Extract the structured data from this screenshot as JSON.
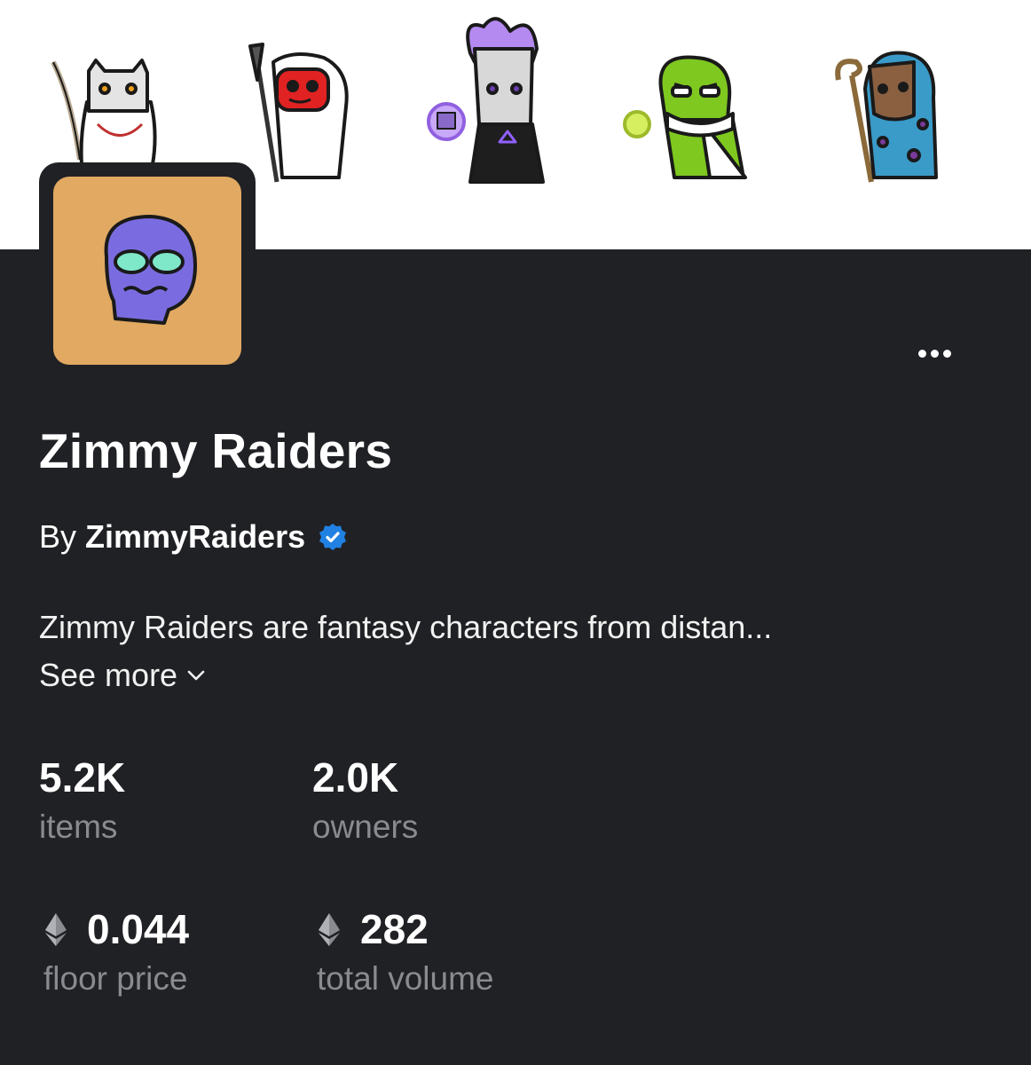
{
  "collection": {
    "title": "Zimmy Raiders",
    "by_prefix": "By",
    "creator": "ZimmyRaiders",
    "verified_icon": "verified-badge-icon",
    "description": "Zimmy Raiders are fantasy characters from distan...",
    "see_more": "See more",
    "more_icon": "ellipsis-icon"
  },
  "stats": {
    "items": {
      "value": "5.2K",
      "label": "items"
    },
    "owners": {
      "value": "2.0K",
      "label": "owners"
    },
    "floor_price": {
      "value": "0.044",
      "label": "floor price",
      "currency_icon": "ethereum-icon"
    },
    "total_volume": {
      "value": "282",
      "label": "total volume",
      "currency_icon": "ethereum-icon"
    }
  },
  "colors": {
    "background": "#202125",
    "banner_bg": "#ffffff",
    "avatar_bg": "#e1a961",
    "muted_text": "#8a8b90",
    "verified_blue": "#2081e2"
  }
}
